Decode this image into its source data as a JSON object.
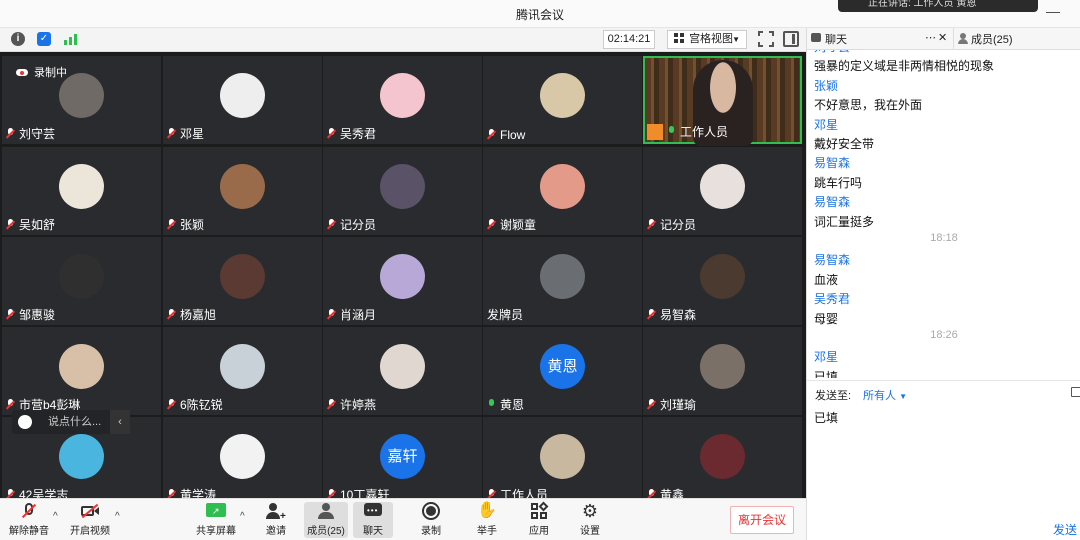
{
  "window": {
    "title": "腾讯会议"
  },
  "toast": {
    "text": "正在讲话: 工作人员 黄恩"
  },
  "topbar": {
    "timer": "02:14:21",
    "view_label": "宫格视图",
    "icons": [
      "info-icon",
      "shield-icon",
      "signal-icon",
      "fullscreen-icon",
      "sidebar-toggle-icon"
    ]
  },
  "recording": {
    "label": "录制中"
  },
  "tiles": [
    {
      "name": "刘守芸",
      "avatar": "photo",
      "color": "#6f6a65",
      "mic": "muted"
    },
    {
      "name": "邓星",
      "avatar": "photo",
      "color": "#eeeeee",
      "mic": "muted"
    },
    {
      "name": "吴秀君",
      "avatar": "photo",
      "color": "#f4c5cf",
      "mic": "muted"
    },
    {
      "name": "Flow",
      "avatar": "photo",
      "color": "#d8c8a8",
      "mic": "muted"
    },
    {
      "name": "工作人员",
      "avatar": "video",
      "color": "#4a3b2a",
      "mic": "on"
    },
    {
      "name": "吴如舒",
      "avatar": "photo",
      "color": "#ece6da",
      "mic": "muted"
    },
    {
      "name": "张颖",
      "avatar": "photo",
      "color": "#9a6b4a",
      "mic": "muted"
    },
    {
      "name": "记分员",
      "avatar": "photo",
      "color": "#5a5266",
      "mic": "muted"
    },
    {
      "name": "谢颖童",
      "avatar": "photo",
      "color": "#e49a88",
      "mic": "muted"
    },
    {
      "name": "记分员",
      "avatar": "photo",
      "color": "#e8e0dc",
      "mic": "muted"
    },
    {
      "name": "邹惠骏",
      "avatar": "photo",
      "color": "#2f2f2f",
      "mic": "muted"
    },
    {
      "name": "杨嘉旭",
      "avatar": "photo",
      "color": "#5a3a32",
      "mic": "muted"
    },
    {
      "name": "肖涵月",
      "avatar": "photo",
      "color": "#b8a8d8",
      "mic": "muted"
    },
    {
      "name": "发牌员",
      "avatar": "photo",
      "color": "#6a6e72",
      "mic": "none"
    },
    {
      "name": "易智森",
      "avatar": "photo",
      "color": "#4a3a30",
      "mic": "muted"
    },
    {
      "name": "市营b4彭琳",
      "avatar": "photo",
      "color": "#d8c0a8",
      "mic": "muted"
    },
    {
      "name": "6陈钇锐",
      "avatar": "photo",
      "color": "#c8d0d8",
      "mic": "muted"
    },
    {
      "name": "许婷燕",
      "avatar": "photo",
      "color": "#e0d8d0",
      "mic": "muted"
    },
    {
      "name": "黄恩",
      "avatar": "letter",
      "letters": "黄恩",
      "color": "#1a73e8",
      "mic": "on"
    },
    {
      "name": "刘瑾瑜",
      "avatar": "photo",
      "color": "#7a7068",
      "mic": "muted"
    },
    {
      "name": "42吴学志",
      "avatar": "photo",
      "color": "#4ab6e0",
      "mic": "muted"
    },
    {
      "name": "黄学涛",
      "avatar": "photo",
      "color": "#f2f2f2",
      "mic": "muted"
    },
    {
      "name": "10丁嘉轩",
      "avatar": "letter",
      "letters": "嘉轩",
      "color": "#1a73e8",
      "mic": "muted"
    },
    {
      "name": "工作人员",
      "avatar": "photo",
      "color": "#c8b8a0",
      "mic": "muted"
    },
    {
      "name": "黄鑫",
      "avatar": "photo",
      "color": "#6a2a30",
      "mic": "muted"
    }
  ],
  "reaction_bar": {
    "placeholder": "说点什么..."
  },
  "bottombar": {
    "unmute": "解除静音",
    "start_video": "开启视频",
    "share_screen": "共享屏幕",
    "invite": "邀请",
    "members": "成员(25)",
    "chat": "聊天",
    "record": "录制",
    "raise_hand": "举手",
    "apps": "应用",
    "settings": "设置",
    "leave": "离开会议"
  },
  "side": {
    "chat_tab": "聊天",
    "members_tab": "成员(25)",
    "messages": [
      {
        "type": "sender",
        "text": "刘守芸"
      },
      {
        "type": "text",
        "text": "强暴的定义域是非两情相悦的现象"
      },
      {
        "type": "sender",
        "text": "张颖"
      },
      {
        "type": "text",
        "text": "不好意思，我在外面"
      },
      {
        "type": "sender",
        "text": "邓星"
      },
      {
        "type": "text",
        "text": "戴好安全带"
      },
      {
        "type": "sender",
        "text": "易智森"
      },
      {
        "type": "text",
        "text": "跳车行吗"
      },
      {
        "type": "sender",
        "text": "易智森"
      },
      {
        "type": "text",
        "text": "词汇量挺多"
      },
      {
        "type": "time",
        "text": "18:18"
      },
      {
        "type": "sender",
        "text": "易智森"
      },
      {
        "type": "text",
        "text": "血液"
      },
      {
        "type": "sender",
        "text": "吴秀君"
      },
      {
        "type": "text",
        "text": "母婴"
      },
      {
        "type": "time",
        "text": "18:26"
      },
      {
        "type": "sender",
        "text": "邓星"
      },
      {
        "type": "text",
        "text": "已填"
      }
    ],
    "send_to_label": "发送至:",
    "send_to_value": "所有人",
    "compose_value": "已填",
    "send_button": "发送(S)"
  }
}
